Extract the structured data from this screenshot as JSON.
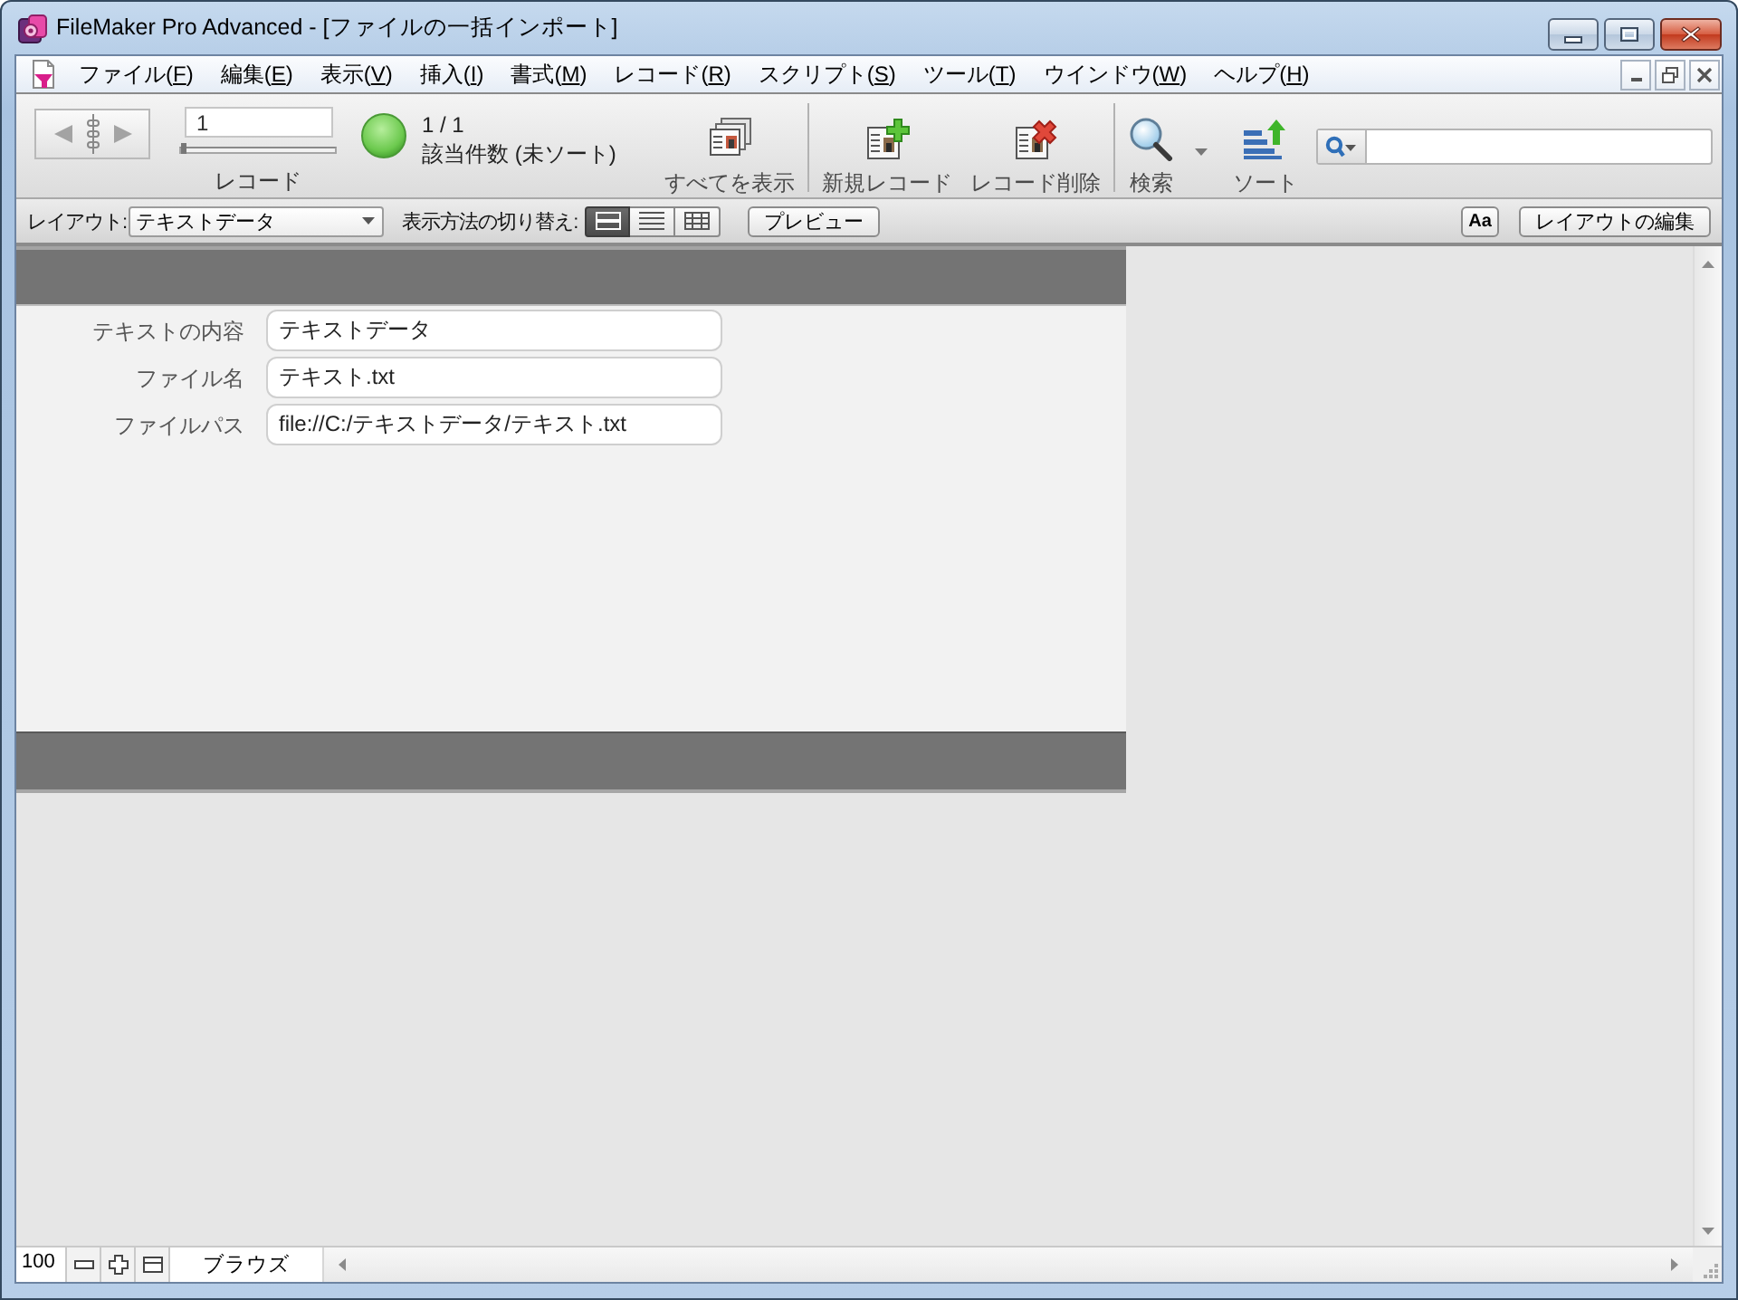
{
  "window": {
    "title": "FileMaker Pro Advanced - [ファイルの一括インポート]"
  },
  "menu_bar": {
    "items": [
      {
        "label": "ファイル(",
        "access_key": "F",
        "label_end": ")"
      },
      {
        "label": "編集(",
        "access_key": "E",
        "label_end": ")"
      },
      {
        "label": "表示(",
        "access_key": "V",
        "label_end": ")"
      },
      {
        "label": "挿入(",
        "access_key": "I",
        "label_end": ")"
      },
      {
        "label": "書式(",
        "access_key": "M",
        "label_end": ")"
      },
      {
        "label": "レコード(",
        "access_key": "R",
        "label_end": ")"
      },
      {
        "label": "スクリプト(",
        "access_key": "S",
        "label_end": ")"
      },
      {
        "label": "ツール(",
        "access_key": "T",
        "label_end": ")"
      },
      {
        "label": "ウインドウ(",
        "access_key": "W",
        "label_end": ")"
      },
      {
        "label": "ヘルプ(",
        "access_key": "H",
        "label_end": ")"
      }
    ]
  },
  "toolbar": {
    "record_number": "1",
    "record_slider": {
      "level": 0
    },
    "record_label": "レコード",
    "found_count": "1 / 1",
    "found_status": "該当件数 (未ソート)",
    "groups": [
      {
        "buttons": [
          {
            "kind": "show_all",
            "label": "すべてを表示",
            "has_menu": false
          }
        ]
      },
      {
        "buttons": [
          {
            "kind": "new_record",
            "label": "新規レコード",
            "has_menu": false
          },
          {
            "kind": "delete_record",
            "label": "レコード削除",
            "has_menu": false
          }
        ]
      },
      {
        "buttons": [
          {
            "kind": "find",
            "label": "検索",
            "has_menu": true
          },
          {
            "kind": "sort",
            "label": "ソート",
            "has_menu": false
          }
        ]
      }
    ]
  },
  "layout_bar": {
    "layout_label": "レイアウト:",
    "layout_menu": "テキストデータ",
    "view_label": "表示方法の切り替え:",
    "view_modes": [
      {
        "kind": "form",
        "selected": true
      },
      {
        "kind": "list",
        "selected": false
      },
      {
        "kind": "table",
        "selected": false
      }
    ],
    "preview_button": "プレビュー",
    "format_button": "Aa",
    "edit_layout_button": "レイアウトの編集"
  },
  "form": {
    "fields": [
      {
        "label": "テキストの内容",
        "value": "テキストデータ"
      },
      {
        "label": "ファイル名",
        "value": "テキスト.txt"
      },
      {
        "label": "ファイルパス",
        "value": "file://C:/テキストデータ/テキスト.txt"
      }
    ]
  },
  "status_bar": {
    "zoom": "100",
    "mode": "ブラウズ"
  }
}
